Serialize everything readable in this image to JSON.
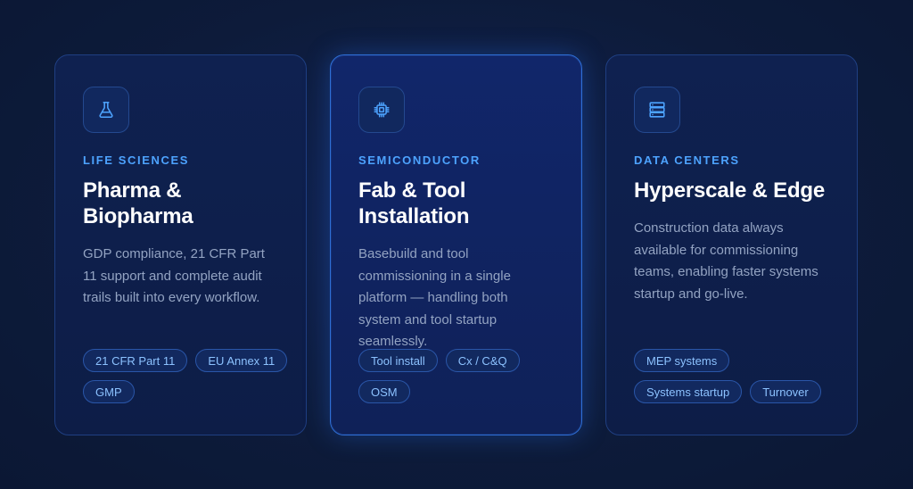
{
  "cards": [
    {
      "icon": "flask-icon",
      "eyebrow": "LIFE SCIENCES",
      "title_line1": "Pharma &",
      "title_line2": "Biopharma",
      "description": "GDP compliance, 21 CFR Part 11 support and complete audit trails built into every workflow.",
      "tags": [
        "21 CFR Part 11",
        "EU Annex 11",
        "GMP"
      ]
    },
    {
      "icon": "chip-icon",
      "eyebrow": "SEMICONDUCTOR",
      "title_line1": "Fab & Tool",
      "title_line2": "Installation",
      "description": "Basebuild and tool commissioning in a single platform — handling both system and tool startup seamlessly.",
      "tags": [
        "Tool install",
        "Cx / C&Q",
        "OSM"
      ]
    },
    {
      "icon": "server-icon",
      "eyebrow": "DATA CENTERS",
      "title_line1": "Hyperscale & Edge",
      "title_line2": "",
      "description": "Construction data always available for commissioning teams, enabling faster systems startup and go-live.",
      "tags": [
        "MEP systems",
        "Systems startup",
        "Turnover"
      ]
    }
  ],
  "colors": {
    "background": "#0d1b3a",
    "accent": "#4da3ff",
    "tag_text": "#8cc2ff",
    "highlight_border": "#2f6fd6"
  }
}
